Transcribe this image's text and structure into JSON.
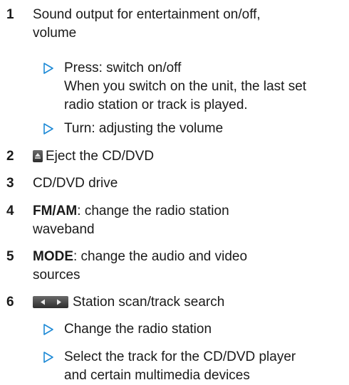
{
  "items": [
    {
      "number": "1",
      "text_lines": [
        "Sound output for entertainment on/off,",
        "volume"
      ],
      "subitems": [
        {
          "lines": [
            "Press: switch on/off",
            "When you switch on the unit, the last set",
            "radio station or track is played."
          ]
        },
        {
          "lines": [
            "Turn: adjusting the volume"
          ]
        }
      ]
    },
    {
      "number": "2",
      "icon": "eject-button-icon",
      "text": "Eject the CD/DVD"
    },
    {
      "number": "3",
      "text": "CD/DVD drive"
    },
    {
      "number": "4",
      "bold": "FM/AM",
      "rest_lines": [
        ": change the radio station",
        "waveband"
      ]
    },
    {
      "number": "5",
      "bold": "MODE",
      "rest_lines": [
        ": change the audio and video",
        "sources"
      ]
    },
    {
      "number": "6",
      "icon": "seek-buttons-icon",
      "text": "Station scan/track search",
      "subitems": [
        {
          "lines": [
            "Change the radio station"
          ]
        },
        {
          "lines": [
            "Select the track for the CD/DVD player",
            "and certain multimedia devices"
          ]
        }
      ]
    }
  ],
  "colors": {
    "text": "#1a1a1a",
    "bullet_triangle": "#1e8ad6",
    "button_fill": "#3a3a3a"
  }
}
